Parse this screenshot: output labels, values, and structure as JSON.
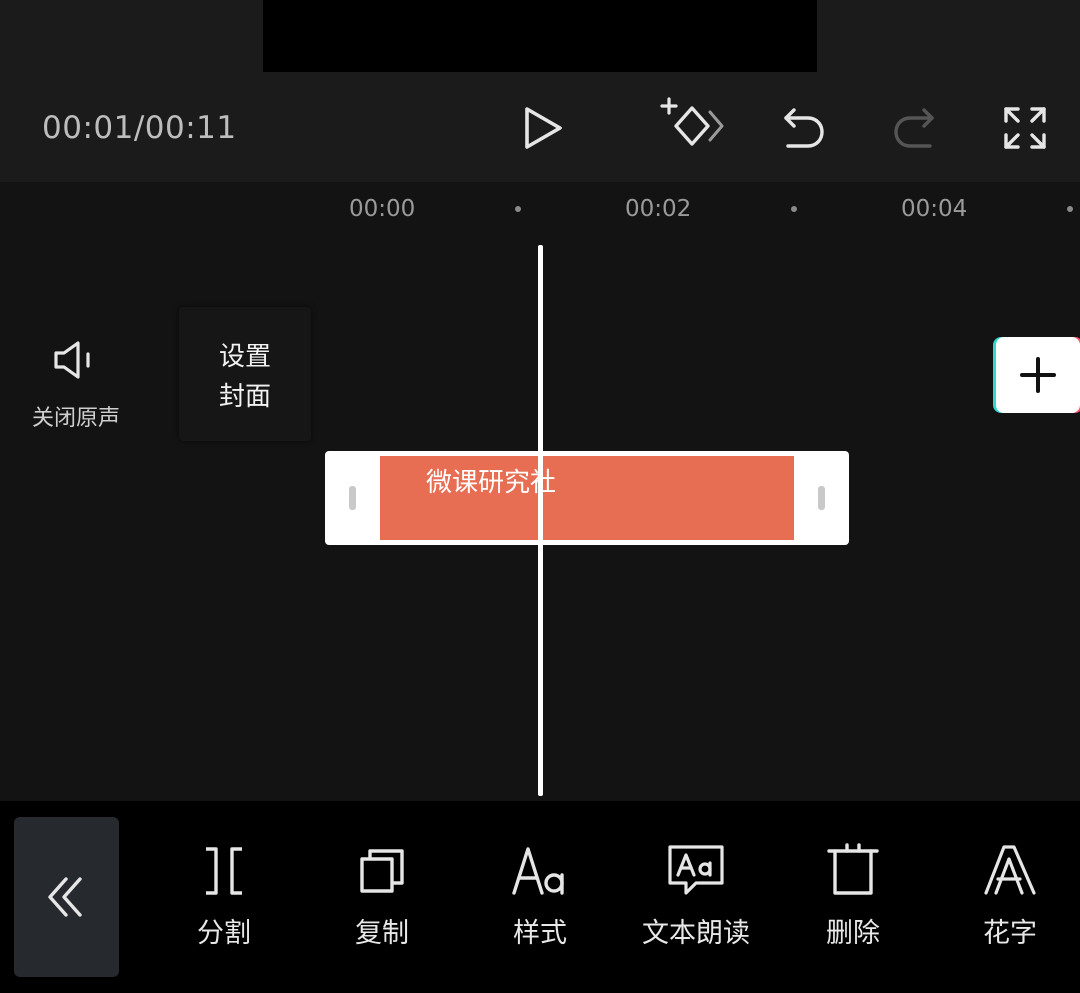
{
  "preview": {
    "time_readout": "00:01/00:11"
  },
  "controls": {
    "play_icon": "play-icon",
    "keyframe_icon": "add-keyframe-icon",
    "undo_icon": "undo-icon",
    "redo_icon": "redo-icon",
    "fullscreen_icon": "fullscreen-icon"
  },
  "ruler": {
    "labels": [
      "00:00",
      "00:02",
      "00:04"
    ]
  },
  "track": {
    "mute_label": "关闭原声",
    "cover_label": "设置\n封面",
    "text_clip_label": "微课研究社"
  },
  "toolbar": {
    "tools": [
      {
        "label": "分割",
        "icon": "split-icon"
      },
      {
        "label": "复制",
        "icon": "copy-icon"
      },
      {
        "label": "样式",
        "icon": "text-style-icon"
      },
      {
        "label": "文本朗读",
        "icon": "text-to-speech-icon"
      },
      {
        "label": "删除",
        "icon": "delete-icon"
      },
      {
        "label": "花字",
        "icon": "fancy-text-icon"
      }
    ]
  },
  "colors": {
    "background": "#131313",
    "clip_fill": "#e76d53",
    "toolbar": "#000000"
  }
}
